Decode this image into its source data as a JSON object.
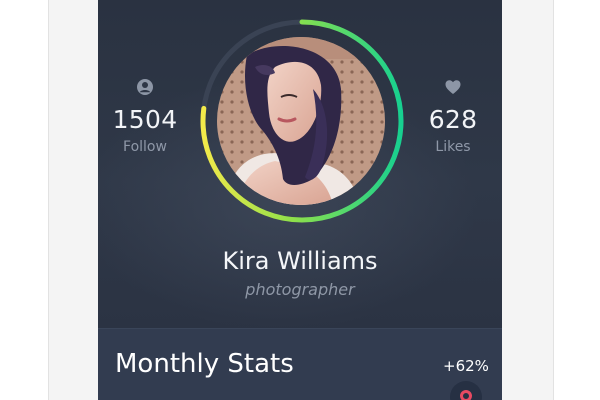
{
  "profile": {
    "name": "Kira Williams",
    "role": "photographer",
    "ring_progress": 0.77,
    "follow": {
      "value": "1504",
      "label": "Follow",
      "icon": "user-icon"
    },
    "likes": {
      "value": "628",
      "label": "Likes",
      "icon": "heart-icon"
    },
    "avatar_icon": "profile-photo"
  },
  "stats_card": {
    "title": "Monthly Stats",
    "change": "+62%"
  },
  "colors": {
    "background": "#2c3444",
    "card": "#323c50",
    "ring_start": "#f3ea4a",
    "ring_end": "#17d090",
    "ring_track": "#3a4354",
    "accent_red": "#e84a62",
    "muted_text": "#8f98a8"
  }
}
